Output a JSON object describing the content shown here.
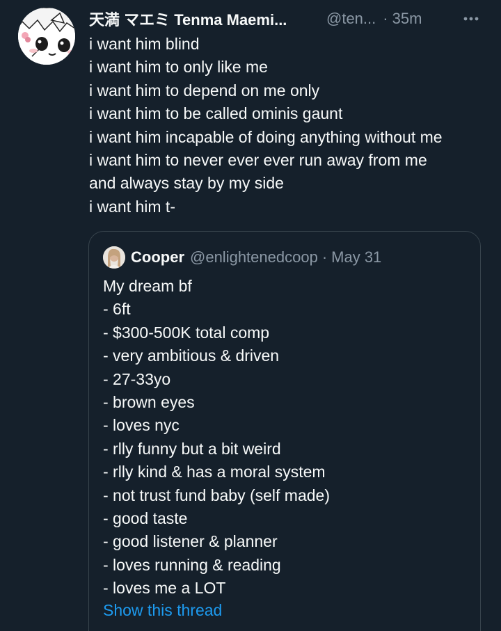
{
  "tweet": {
    "display_name": "天満 マエミ Tenma Maemi...",
    "handle": "@ten...",
    "separator": "·",
    "time": "35m",
    "lines": [
      "i want him blind",
      "i want him to only like me",
      "i want him to depend on me only",
      "i want him to be called ominis gaunt",
      "i want him incapable of doing anything without me",
      "i want him to never ever ever run away from me",
      "and always stay by my side",
      "i want him t-"
    ]
  },
  "quote": {
    "name": "Cooper",
    "handle": "@enlightenedcoop",
    "separator": "·",
    "date": "May 31",
    "lines": [
      "My dream bf",
      "- 6ft",
      "- $300-500K total comp",
      "- very ambitious & driven",
      "- 27-33yo",
      "- brown eyes",
      "- loves nyc",
      "- rlly funny but a bit weird",
      "- rlly kind & has a moral system",
      "- not trust fund baby (self made)",
      "- good taste",
      "- good listener & planner",
      "- loves running & reading",
      "- loves me a LOT"
    ],
    "show_thread_label": "Show this thread"
  },
  "colors": {
    "background": "#15202b",
    "text": "#f7f9f9",
    "secondary_text": "#8b98a5",
    "accent": "#1d9bf0",
    "border": "#38444d"
  },
  "icons": {
    "more": "more-horizontal-icon"
  }
}
